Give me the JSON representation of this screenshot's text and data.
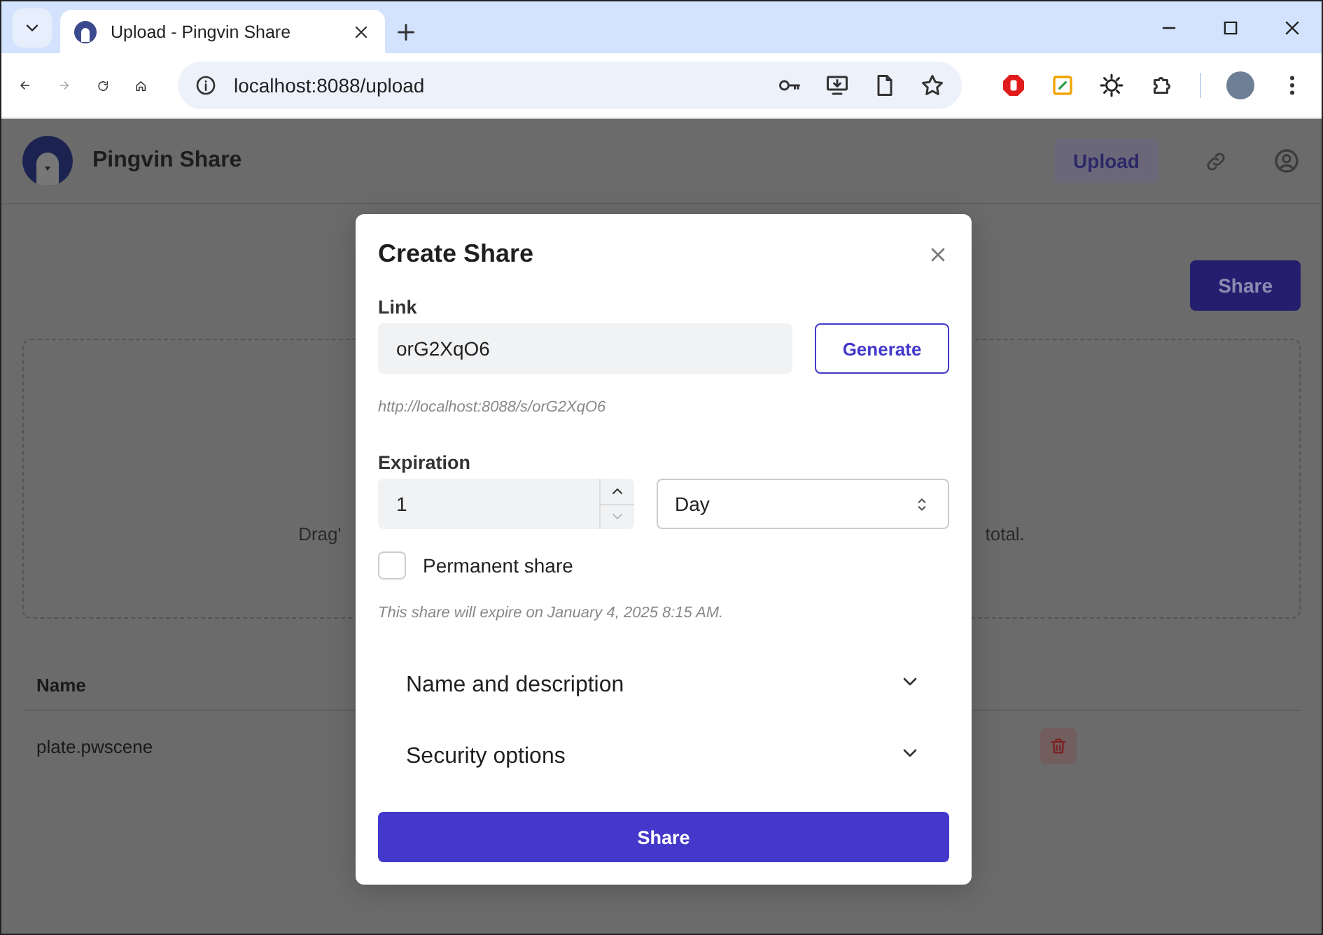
{
  "browser": {
    "tabs": [
      {
        "title": "Upload - Pingvin Share",
        "selected": true
      }
    ],
    "address": "localhost:8088/upload"
  },
  "page": {
    "app_name": "Pingvin Share",
    "upload_button": "Upload",
    "share_button": "Share",
    "dropzone_texts": [
      "Drag'",
      "total."
    ],
    "table": {
      "columns": [
        "Name"
      ],
      "rows": [
        {
          "name": "plate.pwscene"
        }
      ]
    }
  },
  "dialog": {
    "title": "Create Share",
    "link_label": "Link",
    "link_value": "orG2XqO6",
    "generate_button": "Generate",
    "link_url": "http://localhost:8088/s/orG2XqO6",
    "expiration_label": "Expiration",
    "expiration_value": "1",
    "expiration_unit": "Day",
    "permanent": {
      "label": "Permanent share",
      "checked": false
    },
    "expiry_note": "This share will expire on January 4, 2025 8:15 AM.",
    "sections": [
      {
        "label": "Name and description",
        "expanded": false
      },
      {
        "label": "Security options",
        "expanded": false
      }
    ],
    "submit_button": "Share"
  }
}
